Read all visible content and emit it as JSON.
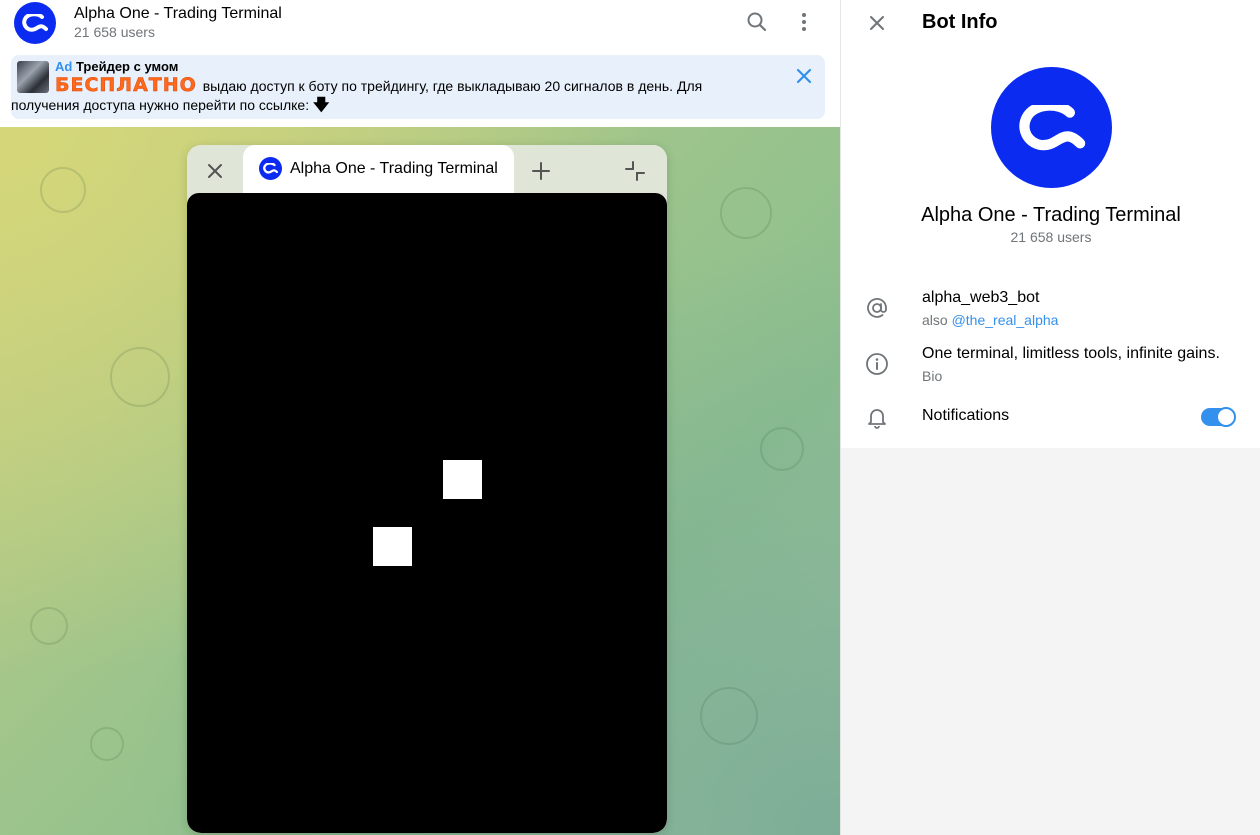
{
  "chat": {
    "title": "Alpha One - Trading Terminal",
    "subtitle": "21 658 users",
    "search_icon": "search-icon",
    "more_icon": "more-vertical-icon"
  },
  "ad": {
    "label": "Ad",
    "name": "Трейдер с умом",
    "highlight": "БЕСПЛАТНО",
    "text_line1": "выдаю доступ к боту по трейдингу, где выкладываю 20 сигналов в день. Для",
    "text_line2": "получения доступа нужно перейти по ссылке:",
    "emoji": "🡇"
  },
  "miniapp": {
    "tab_title": "Alpha One - Trading Terminal"
  },
  "panel": {
    "title": "Bot Info",
    "name": "Alpha One - Trading Terminal",
    "users": "21 658 users",
    "username": "alpha_web3_bot",
    "also_prefix": "also",
    "also_link": "@the_real_alpha",
    "bio": "One terminal, limitless tools, infinite gains.",
    "bio_label": "Bio",
    "notifications_label": "Notifications",
    "notifications_on": true
  },
  "colors": {
    "brand": "#0b2cf0",
    "accent": "#3390ec",
    "free_highlight": "#ff6a1a"
  }
}
